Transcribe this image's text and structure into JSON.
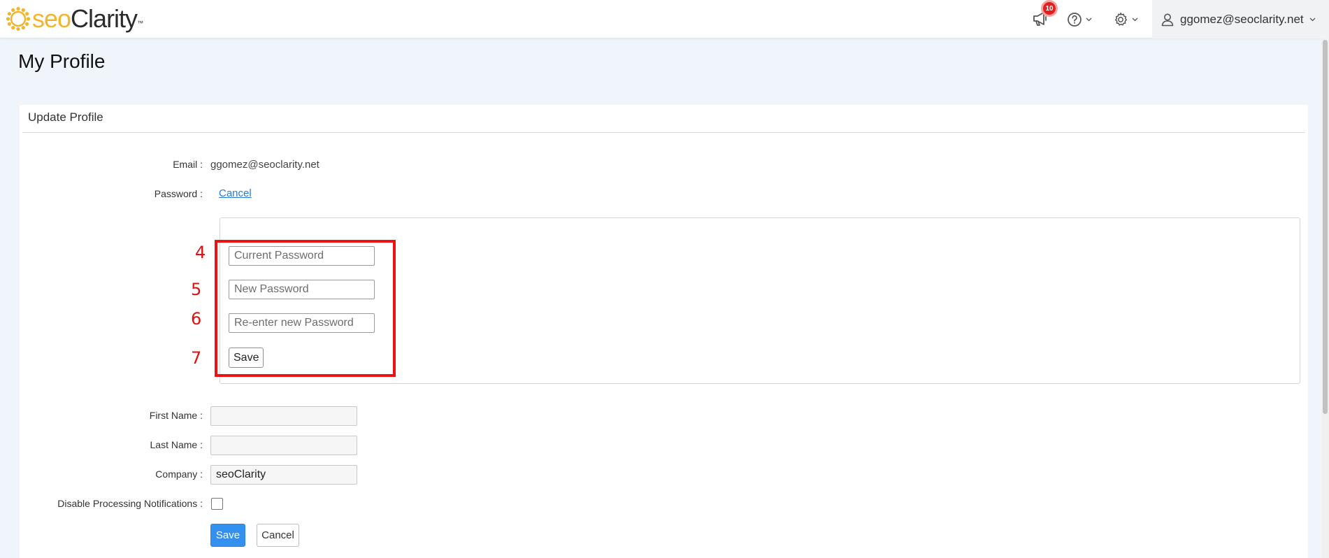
{
  "header": {
    "logo": {
      "brand_seo": "seo",
      "brand_clarity": "Clarity",
      "trademark": "™",
      "brand_color": "#f2b52b"
    },
    "notifications": {
      "icon": "megaphone-icon",
      "count": "10"
    },
    "help": {
      "icon": "question-circle-icon"
    },
    "settings": {
      "icon": "gear-icon"
    },
    "user": {
      "icon": "user-icon",
      "email": "ggomez@seoclarity.net"
    }
  },
  "page": {
    "title": "My Profile"
  },
  "card": {
    "title": "Update Profile",
    "email_label": "Email :",
    "email_value": "ggomez@seoclarity.net",
    "password_label": "Password :",
    "password_cancel": "Cancel",
    "password_form": {
      "current_placeholder": "Current Password",
      "new_placeholder": "New Password",
      "reenter_placeholder": "Re-enter new Password",
      "save_label": "Save"
    },
    "annotations": {
      "step4": "4",
      "step5": "5",
      "step6": "6",
      "step7": "7",
      "color": "#ee1111"
    },
    "first_name_label": "First Name :",
    "first_name_value": "",
    "last_name_label": "Last Name :",
    "last_name_value": "",
    "company_label": "Company :",
    "company_value": "seoClarity",
    "disable_notifications_label": "Disable Processing Notifications :",
    "disable_notifications_checked": false,
    "save_label": "Save",
    "cancel_label": "Cancel",
    "accent_color": "#3390ee"
  }
}
